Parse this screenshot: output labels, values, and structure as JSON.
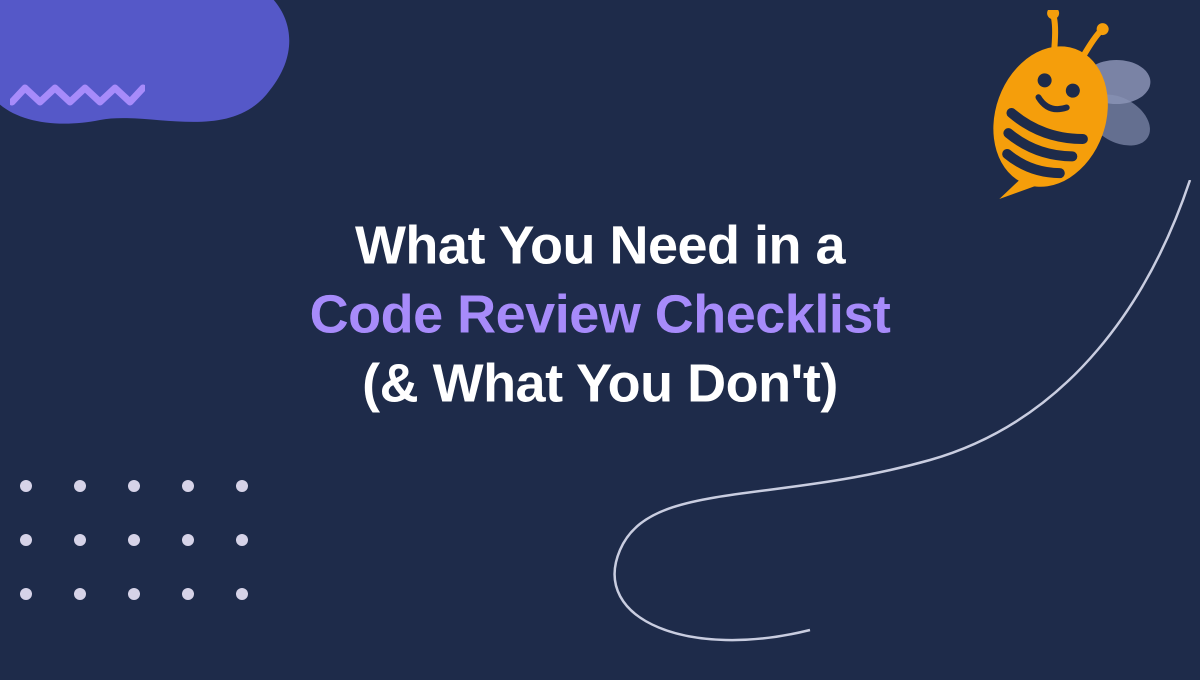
{
  "title": {
    "line1": "What You Need in a",
    "line2": "Code Review Checklist",
    "line3": "(& What You Don't)"
  },
  "colors": {
    "bg": "#1e2b4a",
    "accent": "#a78bfa",
    "blob": "#5558c8",
    "zigzag": "#a78bfa",
    "bee_body": "#f59e0b",
    "bee_wing": "#8b93b5",
    "dot": "#d6d3e8",
    "trail": "#c9cde0"
  }
}
